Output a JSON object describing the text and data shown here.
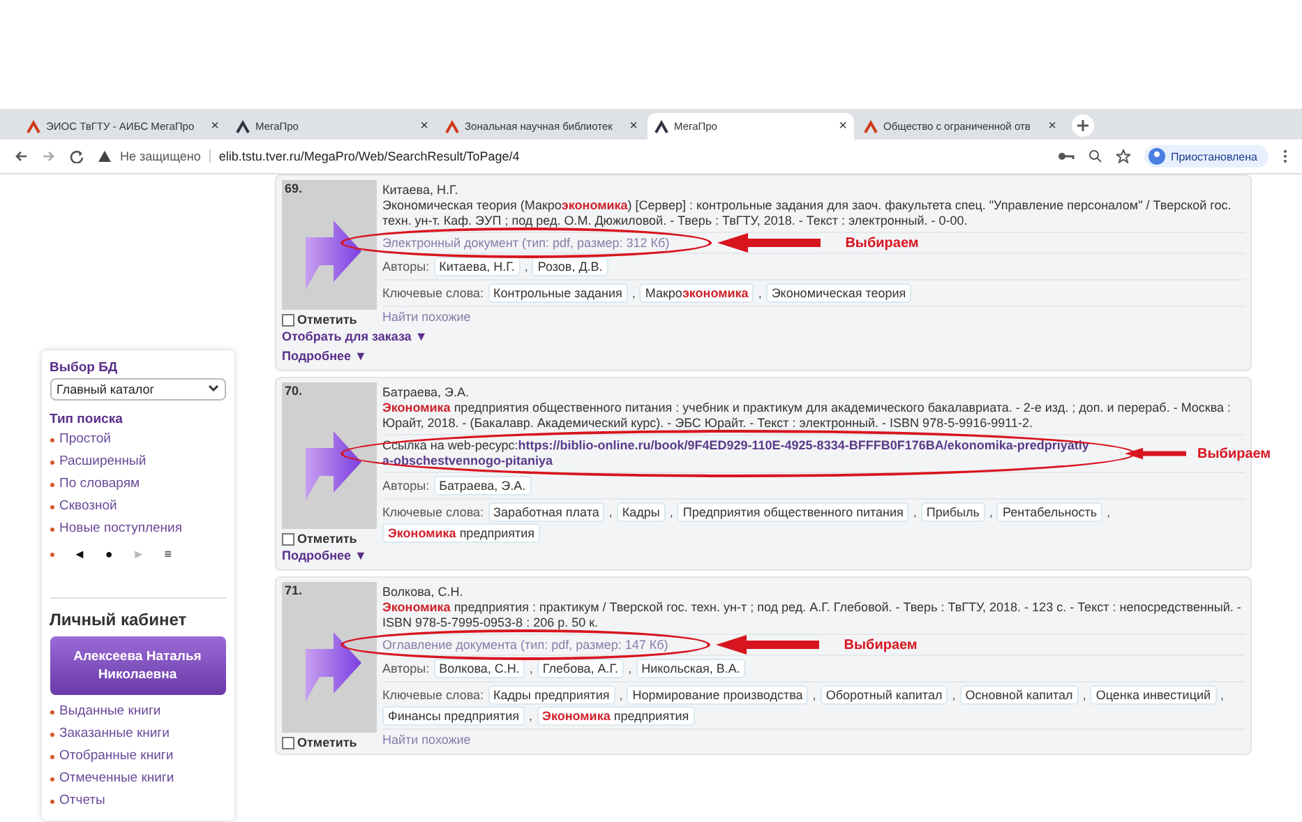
{
  "browser": {
    "tabs": [
      {
        "title": "ЭИОС ТвГТУ - АИБС МегаПро",
        "close": "×",
        "selected": false
      },
      {
        "title": "МегаПро",
        "close": "×",
        "selected": false
      },
      {
        "title": "Зональная научная библиотек",
        "close": "×",
        "selected": false
      },
      {
        "title": "МегаПро",
        "close": "×",
        "selected": true
      },
      {
        "title": "Общество с ограниченной отв",
        "close": "×",
        "selected": false
      }
    ],
    "security": "Не защищено",
    "url": "elib.tstu.tver.ru/MegaPro/Web/SearchResult/ToPage/4",
    "profile": "Приостановлена"
  },
  "sidebar": {
    "db_title": "Выбор БД",
    "db_select": "Главный каталог",
    "search_title": "Тип поиска",
    "search_types": [
      "Простой",
      "Расширенный",
      "По словарям",
      "Сквозной",
      "Новые поступления"
    ],
    "pager": [
      {
        "glyph": "◄",
        "disabled": false
      },
      {
        "glyph": "●",
        "disabled": false
      },
      {
        "glyph": "►",
        "disabled": true
      },
      {
        "glyph": "≡",
        "disabled": false
      }
    ],
    "cabinet_title": "Личный кабинет",
    "user_button": "Алексеева Наталья Николаевна",
    "cabinet_items": [
      "Выданные книги",
      "Заказанные книги",
      "Отобранные книги",
      "Отмеченные книги",
      "Отчеты"
    ]
  },
  "records": [
    {
      "number": "69.",
      "author": "Китаева, Н.Г.",
      "title": "Экономическая теория (Макро**экономика**) [Сервер] : контрольные задания для заоч. факультета спец. \"Управление персоналом\" / Тверской гос. техн. ун-т. Каф. ЭУП ; под ред. О.М. Дюжиловой. - Тверь : ТвГТУ, 2018. - Текст : электронный. - 0-00.",
      "link": {
        "kind": "document",
        "text": "Электронный документ (тип: pdf, размер: 312 Кб)"
      },
      "annotation": "Выбираем",
      "authors_label": "Авторы:",
      "authors": [
        {
          "text": "Китаева, Н.Г.",
          "separator": ","
        },
        {
          "text": "Розов, Д.В."
        }
      ],
      "keywords_label": "Ключевые слова:",
      "keywords": [
        {
          "text": "Контрольные задания",
          "separator": ","
        },
        {
          "text": "Макро**экономика**",
          "separator": ","
        },
        {
          "text": "Экономическая теория"
        }
      ],
      "mark_label": "Отметить",
      "marked": false,
      "similar": "Найти похожие",
      "actions": [
        "Отобрать для заказа ▼",
        "Подробнее ▼"
      ]
    },
    {
      "number": "70.",
      "author": "Батраева, Э.А.",
      "title": "**Экономика** предприятия общественного питания : учебник и практикум для академического бакалавриата. - 2-е изд. ; доп. и перераб. - Москва : Юрайт, 2018. - (Бакалавр. Академический курс). - ЭБС Юрайт. - Текст : электронный. - ISBN 978-5-9916-9911-2.",
      "link": {
        "kind": "web",
        "label": "Ссылка на web-ресурс:",
        "text": "https://biblio-online.ru/book/9F4ED929-110E-4925-8334-BFFFB0F176BA/ekonomika-predpriyatiya-obschestvennogo-pitaniya"
      },
      "annotation": "Выбираем",
      "authors_label": "Авторы:",
      "authors": [
        {
          "text": "Батраева, Э.А."
        }
      ],
      "keywords_label": "Ключевые слова:",
      "keywords": [
        {
          "text": "Заработная плата",
          "separator": ","
        },
        {
          "text": "Кадры",
          "separator": ","
        },
        {
          "text": "Предприятия общественного питания",
          "separator": ","
        },
        {
          "text": "Прибыль",
          "separator": ","
        },
        {
          "text": "Рентабельность",
          "separator": ","
        },
        {
          "text": "**Экономика** предприятия"
        }
      ],
      "mark_label": "Отметить",
      "marked": false,
      "actions": [
        "Подробнее ▼"
      ]
    },
    {
      "number": "71.",
      "author": "Волкова, С.Н.",
      "title": "**Экономика** предприятия : практикум / Тверской гос. техн. ун-т ; под ред. А.Г. Глебовой. - Тверь : ТвГТУ, 2018. - 123 с. - Текст : непосредственный. - ISBN 978-5-7995-0953-8 : 206 р. 50 к.",
      "link": {
        "kind": "document",
        "text": "Оглавление документа (тип: pdf, размер: 147 Кб)"
      },
      "annotation": "Выбираем",
      "authors_label": "Авторы:",
      "authors": [
        {
          "text": "Волкова, С.Н.",
          "separator": ","
        },
        {
          "text": "Глебова, А.Г.",
          "separator": ","
        },
        {
          "text": "Никольская, В.А."
        }
      ],
      "keywords_label": "Ключевые слова:",
      "keywords": [
        {
          "text": "Кадры предприятия",
          "separator": ","
        },
        {
          "text": "Нормирование производства",
          "separator": ","
        },
        {
          "text": "Оборотный капитал",
          "separator": ","
        },
        {
          "text": "Основной капитал",
          "separator": ","
        },
        {
          "text": "Оценка инвестиций",
          "separator": ","
        },
        {
          "text": "Финансы предприятия",
          "separator": ","
        },
        {
          "text": "**Экономика** предприятия"
        }
      ],
      "mark_label": "Отметить",
      "marked": false,
      "similar": "Найти похожие"
    }
  ]
}
